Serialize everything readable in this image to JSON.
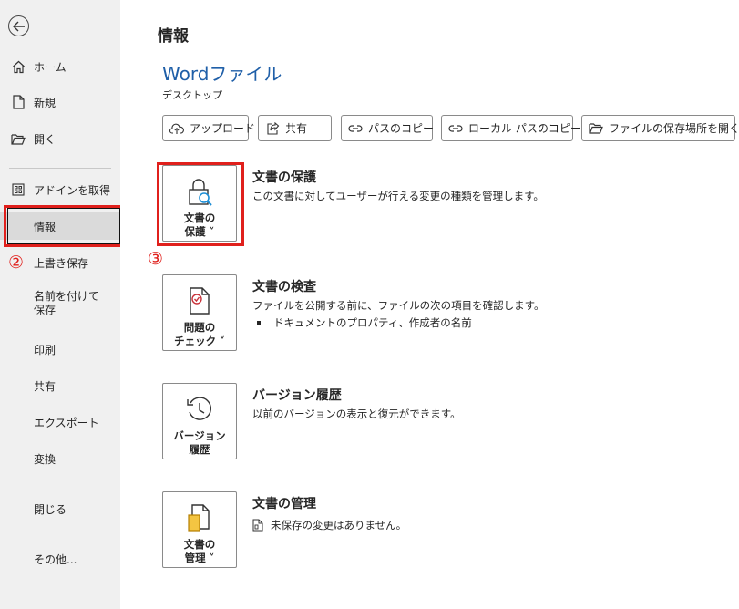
{
  "sidebar": {
    "back_icon": "back-arrow-icon",
    "items": [
      {
        "label": "ホーム",
        "icon": "home-icon"
      },
      {
        "label": "新規",
        "icon": "new-document-icon"
      },
      {
        "label": "開く",
        "icon": "folder-open-icon"
      },
      {
        "label": "アドインを取得",
        "icon": "addins-grid-icon"
      },
      {
        "label": "情報"
      },
      {
        "label": "上書き保存"
      },
      {
        "label": "名前を付けて保存"
      },
      {
        "label": "印刷"
      },
      {
        "label": "共有"
      },
      {
        "label": "エクスポート"
      },
      {
        "label": "変換"
      },
      {
        "label": "閉じる"
      },
      {
        "label": "その他..."
      }
    ]
  },
  "annotations": {
    "step2": "②",
    "step3": "③",
    "highlight_color": "#e0201c"
  },
  "main": {
    "title": "情報",
    "doc_title": "Wordファイル",
    "doc_location": "デスクトップ",
    "toolbar": [
      {
        "label": "アップロード",
        "icon": "cloud-upload-icon"
      },
      {
        "label": "共有",
        "icon": "share-icon"
      },
      {
        "label": "パスのコピー",
        "icon": "link-icon"
      },
      {
        "label": "ローカル パスのコピー",
        "icon": "link-icon"
      },
      {
        "label": "ファイルの保存場所を開く",
        "icon": "folder-icon"
      }
    ],
    "sections": [
      {
        "button_label": "文書の\n保護 ˅",
        "icon": "lock-search-icon",
        "title": "文書の保護",
        "desc": "この文書に対してユーザーが行える変更の種類を管理します。"
      },
      {
        "button_label": "問題の\nチェック ˅",
        "icon": "document-check-icon",
        "title": "文書の検査",
        "desc": "ファイルを公開する前に、ファイルの次の項目を確認します。",
        "bullet": "ドキュメントのプロパティ、作成者の名前"
      },
      {
        "button_label": "バージョン\n履歴",
        "icon": "history-clock-icon",
        "title": "バージョン履歴",
        "desc": "以前のバージョンの表示と復元ができます。"
      },
      {
        "button_label": "文書の\n管理 ˅",
        "icon": "manage-document-icon",
        "title": "文書の管理",
        "desc": "未保存の変更はありません。",
        "desc_icon": "document-info-icon"
      }
    ]
  }
}
